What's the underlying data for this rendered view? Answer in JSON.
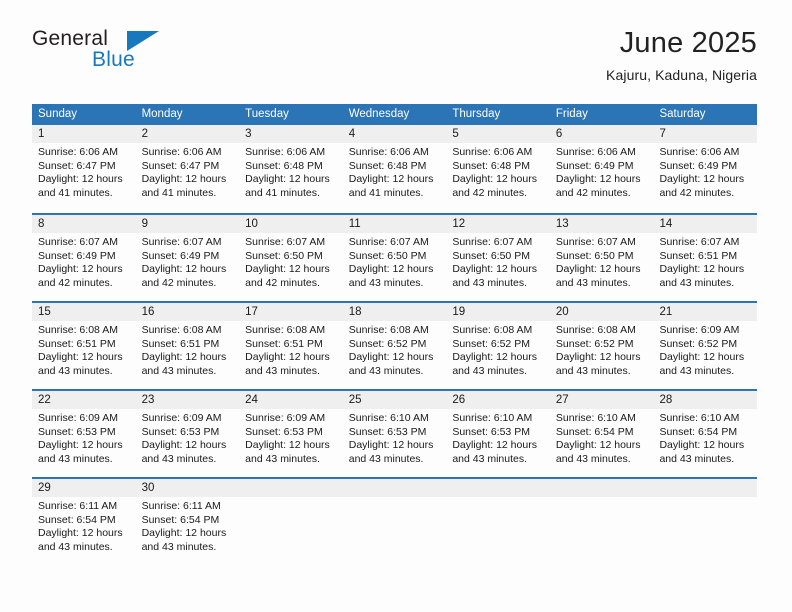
{
  "logo": {
    "word_top": "General",
    "word_bottom": "Blue",
    "triangle_color": "#1878be",
    "text_color": "#231f20"
  },
  "header": {
    "title": "June 2025",
    "subtitle": "Kajuru, Kaduna, Nigeria"
  },
  "theme": {
    "header_blue": "#2b74b6",
    "daynum_band": "#efefef",
    "page_background": "#fdfdfd",
    "text": "#1a1a1a"
  },
  "calendar": {
    "day_names": [
      "Sunday",
      "Monday",
      "Tuesday",
      "Wednesday",
      "Thursday",
      "Friday",
      "Saturday"
    ],
    "weeks": [
      [
        {
          "day": "1",
          "sunrise": "Sunrise: 6:06 AM",
          "sunset": "Sunset: 6:47 PM",
          "daylight_line1": "Daylight: 12 hours",
          "daylight_line2": "and 41 minutes."
        },
        {
          "day": "2",
          "sunrise": "Sunrise: 6:06 AM",
          "sunset": "Sunset: 6:47 PM",
          "daylight_line1": "Daylight: 12 hours",
          "daylight_line2": "and 41 minutes."
        },
        {
          "day": "3",
          "sunrise": "Sunrise: 6:06 AM",
          "sunset": "Sunset: 6:48 PM",
          "daylight_line1": "Daylight: 12 hours",
          "daylight_line2": "and 41 minutes."
        },
        {
          "day": "4",
          "sunrise": "Sunrise: 6:06 AM",
          "sunset": "Sunset: 6:48 PM",
          "daylight_line1": "Daylight: 12 hours",
          "daylight_line2": "and 41 minutes."
        },
        {
          "day": "5",
          "sunrise": "Sunrise: 6:06 AM",
          "sunset": "Sunset: 6:48 PM",
          "daylight_line1": "Daylight: 12 hours",
          "daylight_line2": "and 42 minutes."
        },
        {
          "day": "6",
          "sunrise": "Sunrise: 6:06 AM",
          "sunset": "Sunset: 6:49 PM",
          "daylight_line1": "Daylight: 12 hours",
          "daylight_line2": "and 42 minutes."
        },
        {
          "day": "7",
          "sunrise": "Sunrise: 6:06 AM",
          "sunset": "Sunset: 6:49 PM",
          "daylight_line1": "Daylight: 12 hours",
          "daylight_line2": "and 42 minutes."
        }
      ],
      [
        {
          "day": "8",
          "sunrise": "Sunrise: 6:07 AM",
          "sunset": "Sunset: 6:49 PM",
          "daylight_line1": "Daylight: 12 hours",
          "daylight_line2": "and 42 minutes."
        },
        {
          "day": "9",
          "sunrise": "Sunrise: 6:07 AM",
          "sunset": "Sunset: 6:49 PM",
          "daylight_line1": "Daylight: 12 hours",
          "daylight_line2": "and 42 minutes."
        },
        {
          "day": "10",
          "sunrise": "Sunrise: 6:07 AM",
          "sunset": "Sunset: 6:50 PM",
          "daylight_line1": "Daylight: 12 hours",
          "daylight_line2": "and 42 minutes."
        },
        {
          "day": "11",
          "sunrise": "Sunrise: 6:07 AM",
          "sunset": "Sunset: 6:50 PM",
          "daylight_line1": "Daylight: 12 hours",
          "daylight_line2": "and 43 minutes."
        },
        {
          "day": "12",
          "sunrise": "Sunrise: 6:07 AM",
          "sunset": "Sunset: 6:50 PM",
          "daylight_line1": "Daylight: 12 hours",
          "daylight_line2": "and 43 minutes."
        },
        {
          "day": "13",
          "sunrise": "Sunrise: 6:07 AM",
          "sunset": "Sunset: 6:50 PM",
          "daylight_line1": "Daylight: 12 hours",
          "daylight_line2": "and 43 minutes."
        },
        {
          "day": "14",
          "sunrise": "Sunrise: 6:07 AM",
          "sunset": "Sunset: 6:51 PM",
          "daylight_line1": "Daylight: 12 hours",
          "daylight_line2": "and 43 minutes."
        }
      ],
      [
        {
          "day": "15",
          "sunrise": "Sunrise: 6:08 AM",
          "sunset": "Sunset: 6:51 PM",
          "daylight_line1": "Daylight: 12 hours",
          "daylight_line2": "and 43 minutes."
        },
        {
          "day": "16",
          "sunrise": "Sunrise: 6:08 AM",
          "sunset": "Sunset: 6:51 PM",
          "daylight_line1": "Daylight: 12 hours",
          "daylight_line2": "and 43 minutes."
        },
        {
          "day": "17",
          "sunrise": "Sunrise: 6:08 AM",
          "sunset": "Sunset: 6:51 PM",
          "daylight_line1": "Daylight: 12 hours",
          "daylight_line2": "and 43 minutes."
        },
        {
          "day": "18",
          "sunrise": "Sunrise: 6:08 AM",
          "sunset": "Sunset: 6:52 PM",
          "daylight_line1": "Daylight: 12 hours",
          "daylight_line2": "and 43 minutes."
        },
        {
          "day": "19",
          "sunrise": "Sunrise: 6:08 AM",
          "sunset": "Sunset: 6:52 PM",
          "daylight_line1": "Daylight: 12 hours",
          "daylight_line2": "and 43 minutes."
        },
        {
          "day": "20",
          "sunrise": "Sunrise: 6:08 AM",
          "sunset": "Sunset: 6:52 PM",
          "daylight_line1": "Daylight: 12 hours",
          "daylight_line2": "and 43 minutes."
        },
        {
          "day": "21",
          "sunrise": "Sunrise: 6:09 AM",
          "sunset": "Sunset: 6:52 PM",
          "daylight_line1": "Daylight: 12 hours",
          "daylight_line2": "and 43 minutes."
        }
      ],
      [
        {
          "day": "22",
          "sunrise": "Sunrise: 6:09 AM",
          "sunset": "Sunset: 6:53 PM",
          "daylight_line1": "Daylight: 12 hours",
          "daylight_line2": "and 43 minutes."
        },
        {
          "day": "23",
          "sunrise": "Sunrise: 6:09 AM",
          "sunset": "Sunset: 6:53 PM",
          "daylight_line1": "Daylight: 12 hours",
          "daylight_line2": "and 43 minutes."
        },
        {
          "day": "24",
          "sunrise": "Sunrise: 6:09 AM",
          "sunset": "Sunset: 6:53 PM",
          "daylight_line1": "Daylight: 12 hours",
          "daylight_line2": "and 43 minutes."
        },
        {
          "day": "25",
          "sunrise": "Sunrise: 6:10 AM",
          "sunset": "Sunset: 6:53 PM",
          "daylight_line1": "Daylight: 12 hours",
          "daylight_line2": "and 43 minutes."
        },
        {
          "day": "26",
          "sunrise": "Sunrise: 6:10 AM",
          "sunset": "Sunset: 6:53 PM",
          "daylight_line1": "Daylight: 12 hours",
          "daylight_line2": "and 43 minutes."
        },
        {
          "day": "27",
          "sunrise": "Sunrise: 6:10 AM",
          "sunset": "Sunset: 6:54 PM",
          "daylight_line1": "Daylight: 12 hours",
          "daylight_line2": "and 43 minutes."
        },
        {
          "day": "28",
          "sunrise": "Sunrise: 6:10 AM",
          "sunset": "Sunset: 6:54 PM",
          "daylight_line1": "Daylight: 12 hours",
          "daylight_line2": "and 43 minutes."
        }
      ],
      [
        {
          "day": "29",
          "sunrise": "Sunrise: 6:11 AM",
          "sunset": "Sunset: 6:54 PM",
          "daylight_line1": "Daylight: 12 hours",
          "daylight_line2": "and 43 minutes."
        },
        {
          "day": "30",
          "sunrise": "Sunrise: 6:11 AM",
          "sunset": "Sunset: 6:54 PM",
          "daylight_line1": "Daylight: 12 hours",
          "daylight_line2": "and 43 minutes."
        },
        {
          "day": "",
          "sunrise": "",
          "sunset": "",
          "daylight_line1": "",
          "daylight_line2": ""
        },
        {
          "day": "",
          "sunrise": "",
          "sunset": "",
          "daylight_line1": "",
          "daylight_line2": ""
        },
        {
          "day": "",
          "sunrise": "",
          "sunset": "",
          "daylight_line1": "",
          "daylight_line2": ""
        },
        {
          "day": "",
          "sunrise": "",
          "sunset": "",
          "daylight_line1": "",
          "daylight_line2": ""
        },
        {
          "day": "",
          "sunrise": "",
          "sunset": "",
          "daylight_line1": "",
          "daylight_line2": ""
        }
      ]
    ]
  }
}
